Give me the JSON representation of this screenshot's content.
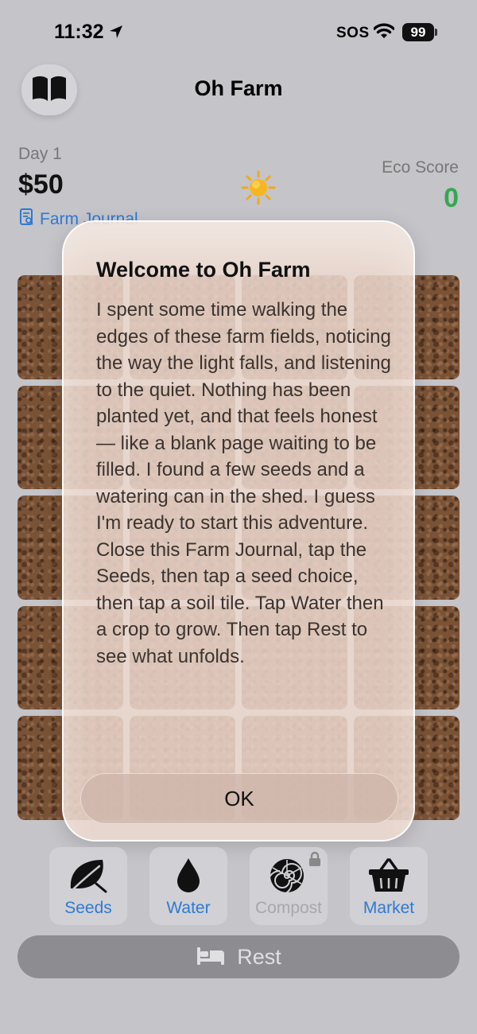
{
  "status_bar": {
    "time": "11:32",
    "sos": "SOS",
    "battery": "99"
  },
  "header": {
    "title": "Oh Farm"
  },
  "stats": {
    "day": "Day 1",
    "money": "$50",
    "journal_link": "Farm Journal",
    "eco_label": "Eco Score",
    "eco_value": "0",
    "weather": "sun-icon"
  },
  "modal": {
    "title": "Welcome to Oh Farm",
    "body": "I spent some time walking the edges of these farm fields, noticing the way the light falls, and listening to the quiet. Nothing has been planted yet, and that feels honest — like a blank page waiting to be filled. I found a few seeds and a watering can in the shed. I guess I'm ready to start this adventure.\nClose this Farm Journal, tap the Seeds, then tap a seed choice, then tap a soil tile. Tap Water then a crop to grow. Then tap Rest to see what unfolds.",
    "ok_label": "OK"
  },
  "toolbar": {
    "seeds_label": "Seeds",
    "water_label": "Water",
    "compost_label": "Compost",
    "market_label": "Market"
  },
  "rest": {
    "label": "Rest"
  },
  "colors": {
    "accent": "#2f7ad0",
    "eco": "#33a852",
    "soil": "#7a5236"
  }
}
